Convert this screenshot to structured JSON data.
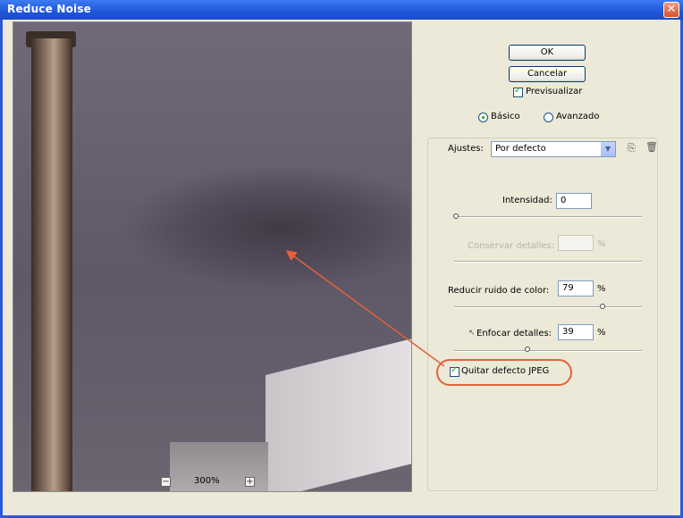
{
  "window": {
    "title": "Reduce Noise",
    "close_symbol": "✕"
  },
  "preview": {
    "zoom": "300%",
    "zoom_out": "−",
    "zoom_in": "+"
  },
  "buttons": {
    "ok": "OK",
    "cancel": "Cancelar"
  },
  "preview_check": {
    "label": "Previsualizar",
    "checked": true
  },
  "mode": {
    "basic": "Básico",
    "advanced": "Avanzado",
    "selected": "basic"
  },
  "settings": {
    "label": "Ajustes:",
    "value": "Por defecto"
  },
  "controls": {
    "intensity": {
      "label": "Intensidad:",
      "value": "0"
    },
    "preserve": {
      "label": "Conservar detalles:",
      "value": "",
      "unit": "%"
    },
    "color_noise": {
      "label": "Reducir ruido de color:",
      "value": "79",
      "unit": "%"
    },
    "sharpen": {
      "label": "Enfocar detalles:",
      "value": "39",
      "unit": "%"
    }
  },
  "jpeg": {
    "label": "Quitar defecto JPEG",
    "checked": true
  },
  "colors": {
    "titlebar": "#1f56d8",
    "annotation": "#e1623a",
    "dialog": "#ece9d8"
  }
}
